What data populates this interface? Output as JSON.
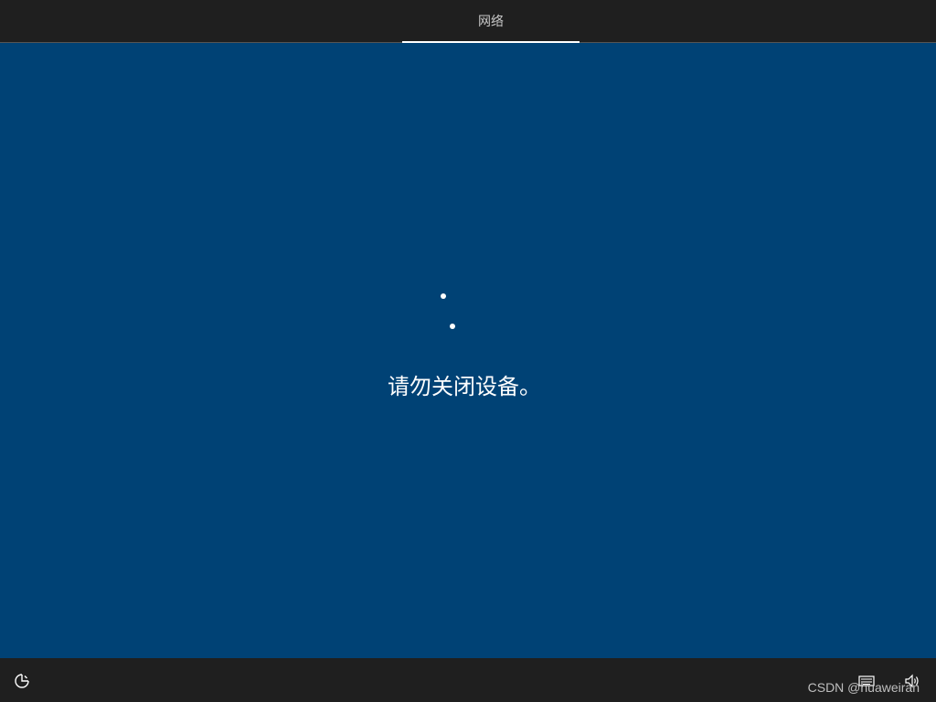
{
  "header": {
    "tabs": [
      {
        "label": "网络",
        "selected": true
      }
    ]
  },
  "main": {
    "message": "请勿关闭设备。",
    "spinner": "loading-dots"
  },
  "footer": {
    "icons": [
      "accessibility-icon",
      "keyboard-icon",
      "volume-icon"
    ],
    "watermark": "CSDN @huaweiran"
  },
  "colors": {
    "background": "#004275",
    "bars": "#1f1f1f",
    "text": "#ffffff",
    "tab_text": "#c8c8c8"
  }
}
